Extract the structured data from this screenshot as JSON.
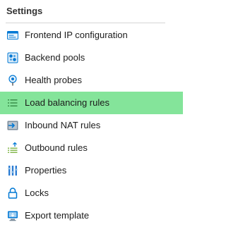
{
  "section": {
    "title": "Settings"
  },
  "menu": {
    "items": [
      {
        "label": "Frontend IP configuration",
        "icon": "frontend-ip-icon",
        "selected": false
      },
      {
        "label": "Backend pools",
        "icon": "backend-pools-icon",
        "selected": false
      },
      {
        "label": "Health probes",
        "icon": "health-probe-icon",
        "selected": false
      },
      {
        "label": "Load balancing rules",
        "icon": "load-balancing-rules-icon",
        "selected": true
      },
      {
        "label": "Inbound NAT rules",
        "icon": "inbound-nat-icon",
        "selected": false
      },
      {
        "label": "Outbound rules",
        "icon": "outbound-rules-icon",
        "selected": false
      },
      {
        "label": "Properties",
        "icon": "properties-icon",
        "selected": false
      },
      {
        "label": "Locks",
        "icon": "lock-icon",
        "selected": false
      },
      {
        "label": "Export template",
        "icon": "export-template-icon",
        "selected": false
      }
    ]
  },
  "colors": {
    "selected_background": "#84e49a",
    "icon_blue": "#0078d4",
    "divider": "#d6d6d6"
  }
}
